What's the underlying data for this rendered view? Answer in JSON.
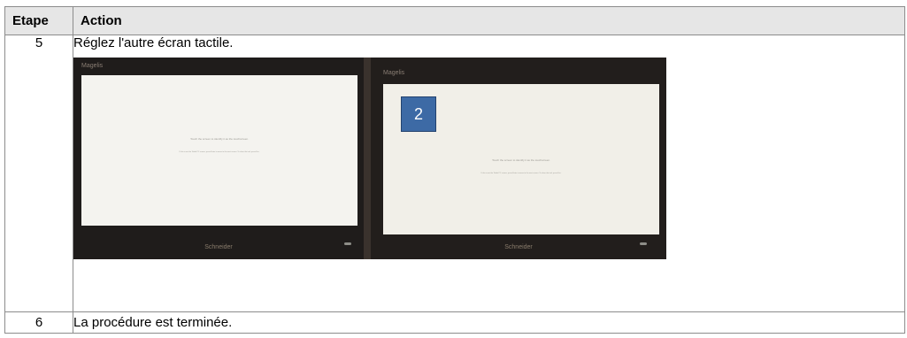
{
  "table": {
    "headers": {
      "step": "Etape",
      "action": "Action"
    },
    "rows": [
      {
        "step": "5",
        "action": "Réglez l'autre écran tactile."
      },
      {
        "step": "6",
        "action": "La procédure est terminée."
      }
    ]
  },
  "photo": {
    "left_monitor": {
      "app_title": "Magelis",
      "prompt": "Touch the screen to identify it as the touchscreen.",
      "instruction": "If this is not the Tablet PC screen, press Enter to move to the next screen. To close the tool, press Esc.",
      "brand": "Schneider"
    },
    "right_monitor": {
      "app_title": "Magelis",
      "prompt": "Touch the screen to identify it as the touchscreen.",
      "instruction": "If this is not the Tablet PC screen, press Enter to move to the next screen. To close the tool, press Esc.",
      "brand": "Schneider",
      "badge": "2"
    }
  }
}
